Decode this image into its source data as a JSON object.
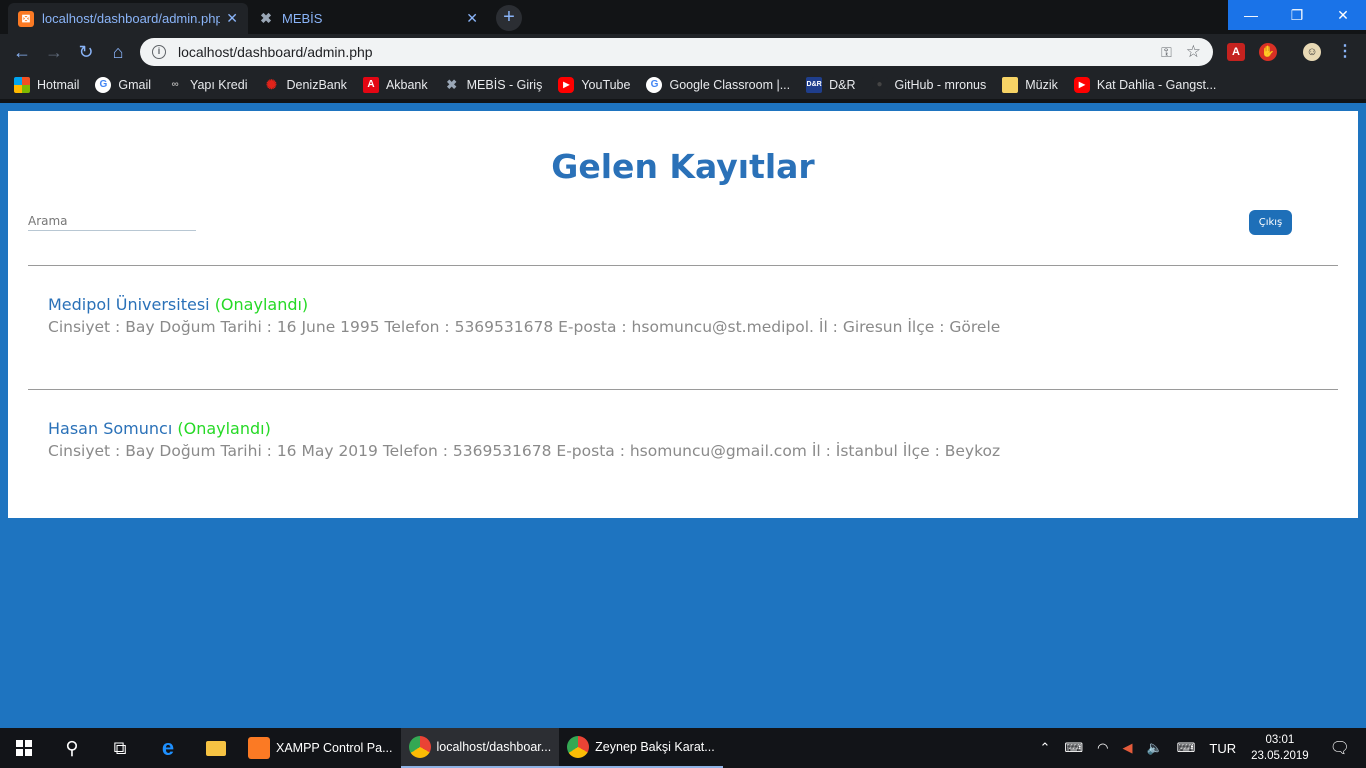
{
  "browser": {
    "tabs": [
      {
        "title": "localhost/dashboard/admin.php",
        "icon": "xampp-icon",
        "active": true
      },
      {
        "title": "MEBİS",
        "icon": "mebis-icon",
        "active": false
      }
    ],
    "address": "localhost/dashboard/admin.php",
    "bookmarks": [
      {
        "label": "Hotmail",
        "icon": "windows-icon",
        "color": "#f25022"
      },
      {
        "label": "Gmail",
        "icon": "google-icon",
        "color": "#ffffff"
      },
      {
        "label": "Yapı Kredi",
        "icon": "yapikredi-icon",
        "color": "#888888"
      },
      {
        "label": "DenizBank",
        "icon": "denizbank-icon",
        "color": "#e2231a"
      },
      {
        "label": "Akbank",
        "icon": "akbank-icon",
        "color": "#e30613"
      },
      {
        "label": "MEBİS - Giriş",
        "icon": "mebis-icon",
        "color": "#9aa7b6"
      },
      {
        "label": "YouTube",
        "icon": "youtube-icon",
        "color": "#ff0000"
      },
      {
        "label": "Google Classroom |...",
        "icon": "google-icon",
        "color": "#ffffff"
      },
      {
        "label": "D&R",
        "icon": "dr-icon",
        "color": "#1f3e8c"
      },
      {
        "label": "GitHub - mronus",
        "icon": "github-icon",
        "color": "#202327"
      },
      {
        "label": "Müzik",
        "icon": "folder-icon",
        "color": "#f6d365"
      },
      {
        "label": "Kat Dahlia - Gangst...",
        "icon": "youtube-icon",
        "color": "#ff0000"
      }
    ]
  },
  "page": {
    "title": "Gelen Kayıtlar",
    "search_placeholder": "Arama",
    "logout_label": "Çıkış",
    "records": [
      {
        "name": "Medipol Üniversitesi",
        "status": "(Onaylandı)",
        "details": "Cinsiyet : Bay Doğum Tarihi : 16 June 1995 Telefon : 5369531678 E-posta : hsomuncu@st.medipol. İl : Giresun İlçe : Görele"
      },
      {
        "name": "Hasan Somuncı",
        "status": "(Onaylandı)",
        "details": "Cinsiyet : Bay Doğum Tarihi : 16 May 2019 Telefon : 5369531678 E-posta : hsomuncu@gmail.com İl : İstanbul İlçe : Beykoz"
      }
    ]
  },
  "taskbar": {
    "apps": [
      {
        "label": "XAMPP Control Pa...",
        "icon": "xampp-icon",
        "color": "#fb7a24",
        "active": false
      },
      {
        "label": "localhost/dashboar...",
        "icon": "chrome-icon",
        "color": "#4285f4",
        "active": true
      },
      {
        "label": "Zeynep Bakşi Karat...",
        "icon": "chrome-icon",
        "color": "#4285f4",
        "active": false
      }
    ],
    "language": "TUR",
    "time": "03:01",
    "date": "23.05.2019"
  },
  "colors": {
    "background": "#1e74c0",
    "title": "#2a71b8",
    "approved": "#26d926",
    "details": "#8a8a8a"
  }
}
